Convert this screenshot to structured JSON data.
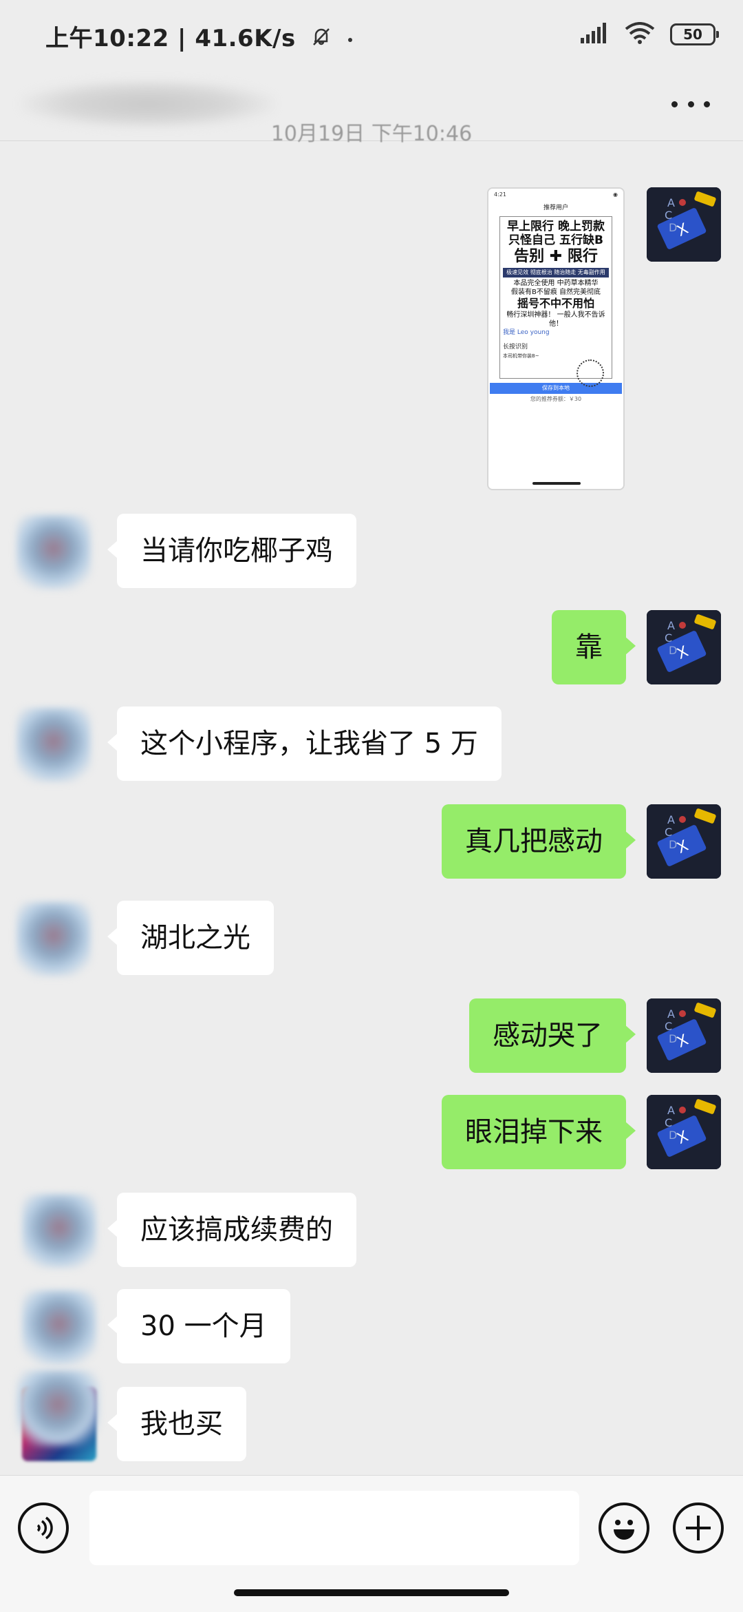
{
  "status_bar": {
    "time_speed": "上午10:22 | 41.6K/s",
    "battery": "50",
    "icons": [
      "bell-muted-icon",
      "signal-icon",
      "wifi-icon",
      "battery-icon"
    ]
  },
  "nav": {
    "title": "",
    "more_icon": "more-icon"
  },
  "timestamp": "10月19日 下午10:46",
  "image_message": {
    "status_time": "4:21",
    "title": "推荐用户",
    "line1": "早上限行 晚上罚款",
    "line2": "只怪自己 五行缺B",
    "big": "告别 ✚ 限行",
    "band": "极速见效 彻底根治 随治随走 无毒副作用",
    "s1": "本品完全使用 中药草本精华",
    "s2": "假装有B不留痕 自然完美彻底",
    "mid": "摇号不中不用怕",
    "s3": "畅行深圳神器！ 一般人我不告诉他！",
    "me": "我是 Leo young",
    "hold": "长按识别",
    "small": "本司机带你装B~",
    "save_btn": "保存到本地",
    "price": "您的推荐券额：￥30"
  },
  "messages": [
    {
      "side": "left",
      "text": "当请你吃椰子鸡"
    },
    {
      "side": "right",
      "text": "靠"
    },
    {
      "side": "left",
      "text": "这个小程序，让我省了 5 万"
    },
    {
      "side": "right",
      "text": "真几把感动"
    },
    {
      "side": "left",
      "text": "湖北之光"
    },
    {
      "side": "right",
      "text": "感动哭了"
    },
    {
      "side": "right",
      "text": "眼泪掉下来"
    },
    {
      "side": "left",
      "text": "应该搞成续费的"
    },
    {
      "side": "left",
      "text": "30 一个月"
    },
    {
      "side": "left",
      "text": "我也买"
    }
  ],
  "input_bar": {
    "voice_icon": "voice-icon",
    "placeholder": "",
    "emoji_icon": "emoji-icon",
    "plus_icon": "plus-icon"
  },
  "colors": {
    "background": "#ededed",
    "right_bubble": "#95ec69",
    "left_bubble": "#ffffff"
  }
}
